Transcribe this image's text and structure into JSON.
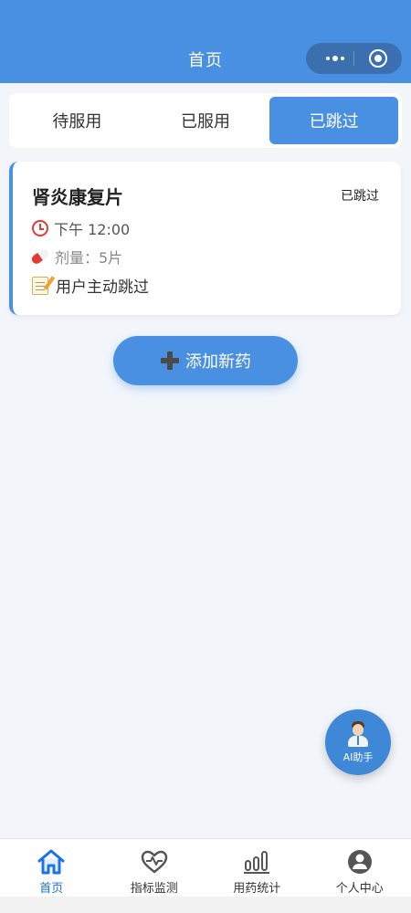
{
  "header": {
    "title": "首页"
  },
  "tabs": [
    {
      "label": "待服用"
    },
    {
      "label": "已服用"
    },
    {
      "label": "已跳过"
    }
  ],
  "active_tab": "已跳过",
  "medication_card": {
    "name": "肾炎康复片",
    "status": "已跳过",
    "time": "下午 12:00",
    "dose": "剂量：5片",
    "note": "用户主动跳过",
    "icons": [
      "alarm-clock-icon",
      "pill-icon",
      "memo-icon"
    ]
  },
  "add_button": {
    "label": "添加新药",
    "icon": "plus-icon"
  },
  "ai_assistant": {
    "label": "AI助手",
    "icon": "doctor-icon"
  },
  "tabbar": {
    "items": [
      {
        "label": "首页",
        "icon": "home-icon",
        "active": true
      },
      {
        "label": "指标监测",
        "icon": "heart-pulse-icon",
        "active": false
      },
      {
        "label": "用药统计",
        "icon": "bar-chart-icon",
        "active": false
      },
      {
        "label": "个人中心",
        "icon": "user-icon",
        "active": false
      }
    ]
  },
  "colors": {
    "primary": "#4a90e2",
    "header_bg": "#4a90e2",
    "page_bg": "#f2f6fb",
    "active_tab_label": "#1a73e8",
    "clock_red": "#e53935"
  }
}
